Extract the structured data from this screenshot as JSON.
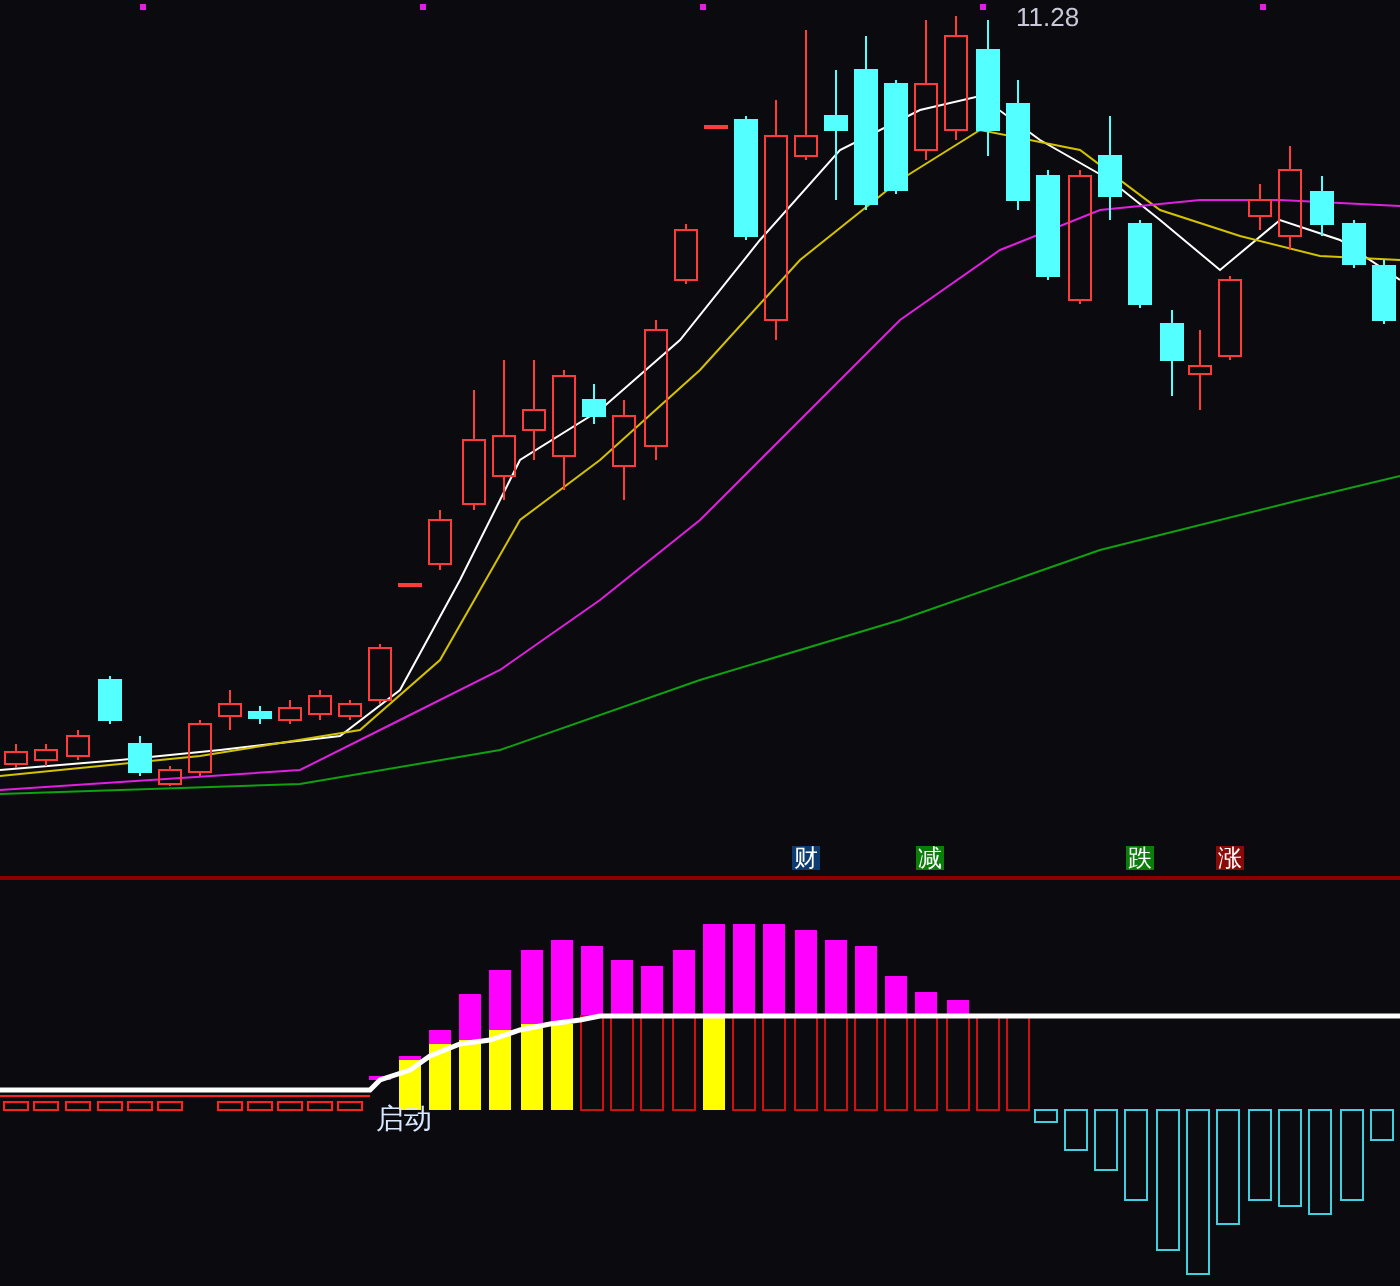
{
  "price_panel": {
    "high_label": "11.28"
  },
  "signals": [
    {
      "label": "财",
      "color": "#0b3b70"
    },
    {
      "label": "减",
      "color": "#0a7d0a"
    },
    {
      "label": "跌",
      "color": "#0a7d0a"
    },
    {
      "label": "涨",
      "color": "#8a0a0a"
    }
  ],
  "indicator_panel": {
    "label": "启动"
  }
}
